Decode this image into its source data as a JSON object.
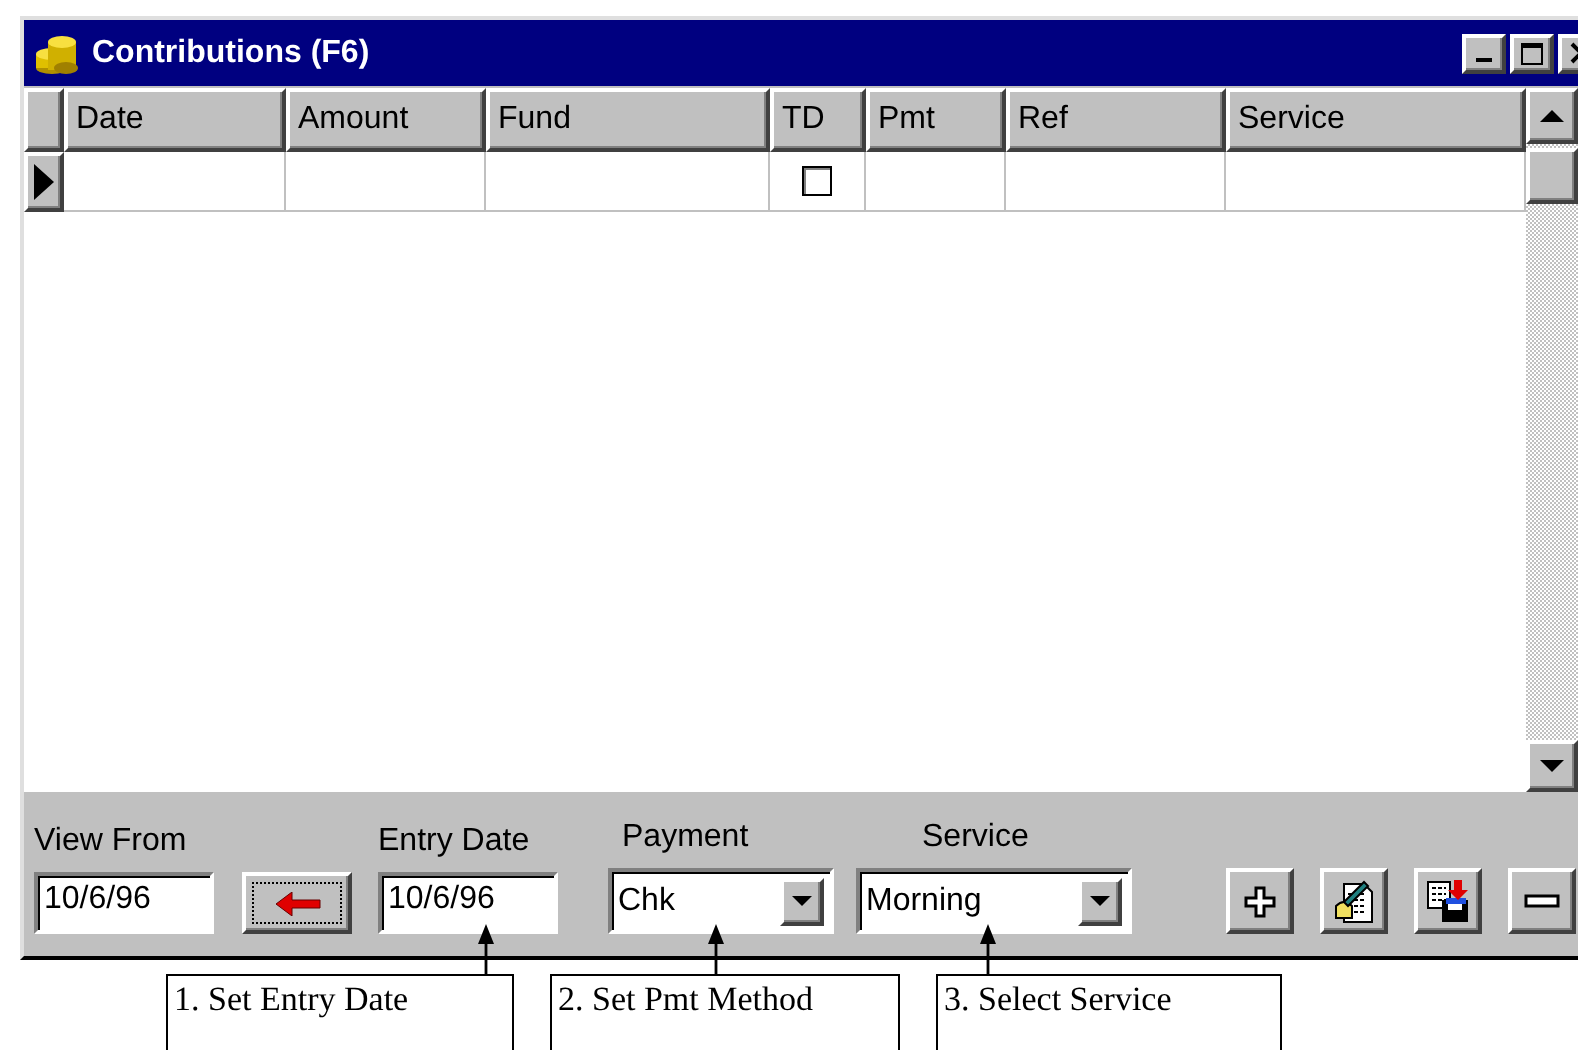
{
  "window": {
    "title": "Contributions (F6)"
  },
  "table": {
    "columns": [
      {
        "label": "Date"
      },
      {
        "label": "Amount"
      },
      {
        "label": "Fund"
      },
      {
        "label": "TD"
      },
      {
        "label": "Pmt"
      },
      {
        "label": "Ref"
      },
      {
        "label": "Service"
      }
    ],
    "rows": [
      {
        "current": true,
        "td": false
      }
    ]
  },
  "panel": {
    "view_from": {
      "label": "View From",
      "value": "10/6/96"
    },
    "entry_date": {
      "label": "Entry Date",
      "value": "10/6/96"
    },
    "payment": {
      "label": "Payment",
      "value": "Chk"
    },
    "service": {
      "label": "Service",
      "value": "Morning"
    },
    "buttons": [
      {
        "kind": "add"
      },
      {
        "kind": "edit"
      },
      {
        "kind": "save"
      },
      {
        "kind": "remove"
      }
    ]
  },
  "callouts": [
    {
      "text": "1. Set Entry Date"
    },
    {
      "text": "2. Set Pmt Method"
    },
    {
      "text": "3. Select Service"
    }
  ]
}
